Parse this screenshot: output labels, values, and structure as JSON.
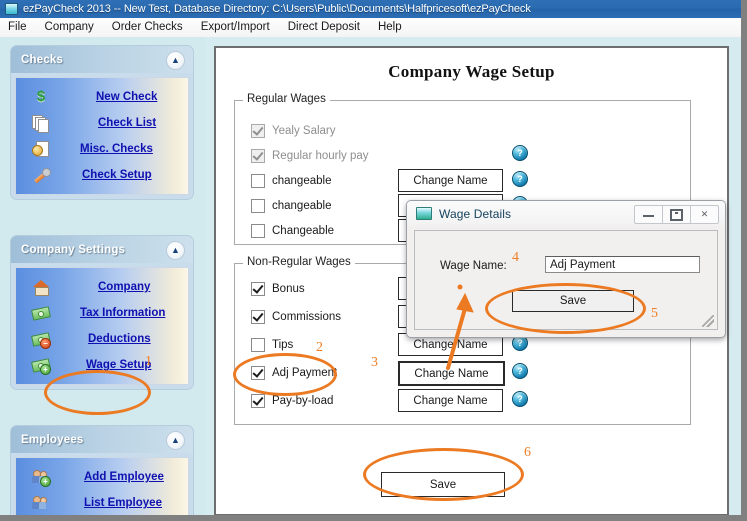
{
  "window": {
    "title": "ezPayCheck 2013 -- New Test, Database Directory: C:\\Users\\Public\\Documents\\Halfpricesoft\\ezPayCheck",
    "icon": "app-icon"
  },
  "menu": {
    "items": [
      {
        "label": "File"
      },
      {
        "label": "Company"
      },
      {
        "label": "Order Checks"
      },
      {
        "label": "Export/Import"
      },
      {
        "label": "Direct Deposit"
      },
      {
        "label": "Help"
      }
    ]
  },
  "sidebar": {
    "panels": [
      {
        "title": "Checks",
        "collapse_icon": "chevron-up-icon",
        "items": [
          {
            "label": "New Check",
            "icon": "dollar-icon"
          },
          {
            "label": "Check List",
            "icon": "documents-stack-icon"
          },
          {
            "label": "Misc. Checks",
            "icon": "document-coin-icon"
          },
          {
            "label": "Check Setup",
            "icon": "wrench-icon"
          }
        ]
      },
      {
        "title": "Company Settings",
        "collapse_icon": "chevron-up-icon",
        "items": [
          {
            "label": "Company",
            "icon": "house-icon"
          },
          {
            "label": "Tax Information",
            "icon": "money-icon"
          },
          {
            "label": "Deductions",
            "icon": "money-minus-icon"
          },
          {
            "label": "Wage Setup",
            "icon": "money-plus-icon"
          }
        ]
      },
      {
        "title": "Employees",
        "collapse_icon": "chevron-up-icon",
        "items": [
          {
            "label": "Add Employee",
            "icon": "person-add-icon"
          },
          {
            "label": "List Employee",
            "icon": "person-list-icon"
          }
        ]
      }
    ]
  },
  "main": {
    "page_title": "Company Wage Setup",
    "regular_wages": {
      "legend": "Regular Wages",
      "rows": [
        {
          "label": "Yealy Salary",
          "checked": true,
          "disabled": true,
          "button": null,
          "help": false
        },
        {
          "label": "Regular hourly pay",
          "checked": true,
          "disabled": true,
          "button": null,
          "help": true
        },
        {
          "label": "changeable",
          "checked": false,
          "disabled": false,
          "button": "Change Name",
          "help": true
        },
        {
          "label": "changeable",
          "checked": false,
          "disabled": false,
          "button": "Change Name",
          "help": true
        },
        {
          "label": "Changeable",
          "checked": false,
          "disabled": false,
          "button": "Change Name",
          "help": true
        }
      ]
    },
    "non_regular_wages": {
      "legend": "Non-Regular Wages",
      "rows": [
        {
          "label": "Bonus",
          "checked": true,
          "button": "Change Name",
          "help": true
        },
        {
          "label": "Commissions",
          "checked": true,
          "button": "Change Name",
          "help": true
        },
        {
          "label": "Tips",
          "checked": false,
          "button": "Change Name",
          "help": true
        },
        {
          "label": "Adj Payment",
          "checked": true,
          "button": "Change Name",
          "help": true
        },
        {
          "label": "Pay-by-load",
          "checked": true,
          "button": "Change Name",
          "help": true
        }
      ]
    },
    "save_button": "Save",
    "help_icon_glyph": "?"
  },
  "dialog": {
    "title": "Wage Details",
    "icon": "window-icon",
    "window_buttons": {
      "minimize": "minimize-icon",
      "maximize": "maximize-icon",
      "close": "✕"
    },
    "wage_name_label": "Wage Name:",
    "wage_name_value": "Adj Payment",
    "save_button": "Save"
  },
  "annotations": {
    "color": "#ec7a22",
    "steps": [
      {
        "num": "1",
        "target": "Wage Setup sidebar link"
      },
      {
        "num": "2",
        "target": "Adj Payment checkbox"
      },
      {
        "num": "3",
        "target": "Change Name button for Adj Payment"
      },
      {
        "num": "4",
        "target": "Wage Name field"
      },
      {
        "num": "5",
        "target": "Dialog Save button"
      },
      {
        "num": "6",
        "target": "Main Save button"
      }
    ]
  }
}
